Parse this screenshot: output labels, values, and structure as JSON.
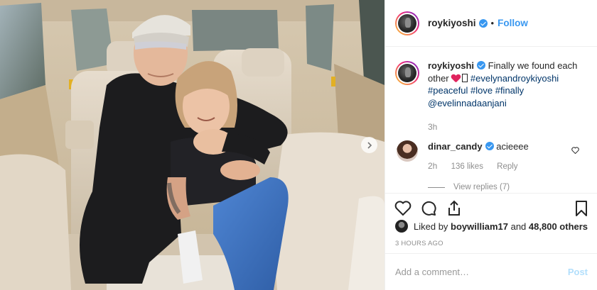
{
  "post": {
    "username": "roykiyoshi",
    "follow_label": "Follow",
    "separator": "•",
    "caption": {
      "username": "roykiyoshi",
      "text": "Finally we found each other",
      "hashtags": [
        "#evelynandroykiyoshi",
        "#peaceful",
        "#love",
        "#finally"
      ],
      "mention": "@evelinnadaanjani",
      "time": "3h"
    },
    "comment": {
      "username": "dinar_candy",
      "text": "acieeee",
      "time": "2h",
      "likes": "136 likes",
      "reply_label": "Reply",
      "view_replies": "View replies (7)"
    },
    "likes_line": {
      "prefix": "Liked by",
      "user": "boywilliam17",
      "middle": "and",
      "count": "48,800 others"
    },
    "timestamp": "3 HOURS AGO",
    "add_comment_placeholder": "Add a comment…",
    "post_button": "Post"
  },
  "icons": {
    "verified": "verified-badge-icon",
    "next": "chevron-right-icon",
    "like": "heart-outline-icon",
    "comment": "comment-bubble-icon",
    "share": "share-arrow-icon",
    "save": "bookmark-icon",
    "heart_small": "heart-small-icon"
  },
  "colors": {
    "link": "#003569",
    "follow": "#3897f0",
    "muted": "#8e8e8e",
    "post_disabled": "#b2dffc",
    "heart_emoji": "#e0245e"
  }
}
